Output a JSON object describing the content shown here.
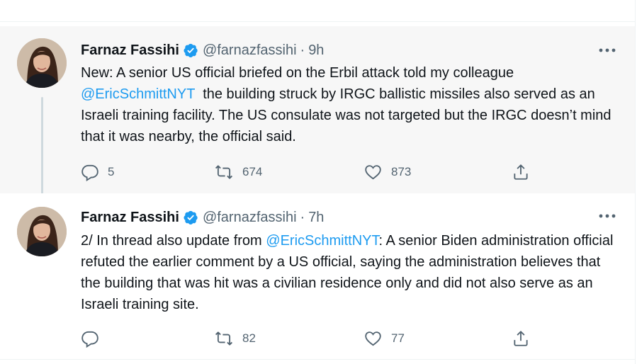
{
  "tweets": [
    {
      "author_name": "Farnaz Fassihi",
      "handle": "@farnazfassihi",
      "separator": "·",
      "time": "9h",
      "text_before": "New: A senior US official briefed on the Erbil attack told my colleague",
      "mention": "@EricSchmittNYT",
      "text_after": "  the building struck by IRGC ballistic missiles also served as an Israeli training facility. The US consulate was not targeted but the IRGC doesn’t mind that it was nearby, the official said.",
      "replies": "5",
      "retweets": "674",
      "likes": "873"
    },
    {
      "author_name": "Farnaz Fassihi",
      "handle": "@farnazfassihi",
      "separator": "·",
      "time": "7h",
      "text_before": "2/ In thread also update from",
      "mention": "@EricSchmittNYT",
      "text_after": ": A senior Biden administration official refuted the earlier comment by a US official, saying the administration believes that the building that was hit was a civilian residence only and did not also serve as an Israeli training site.",
      "replies": "",
      "retweets": "82",
      "likes": "77"
    }
  ],
  "colors": {
    "link": "#1d9bf0",
    "secondary_text": "#536471",
    "verified": "#1d9bf0",
    "highlight_bg": "#f7f7f7"
  },
  "icons": [
    "verified-badge-icon",
    "more-icon",
    "reply-icon",
    "retweet-icon",
    "like-icon",
    "share-icon"
  ]
}
